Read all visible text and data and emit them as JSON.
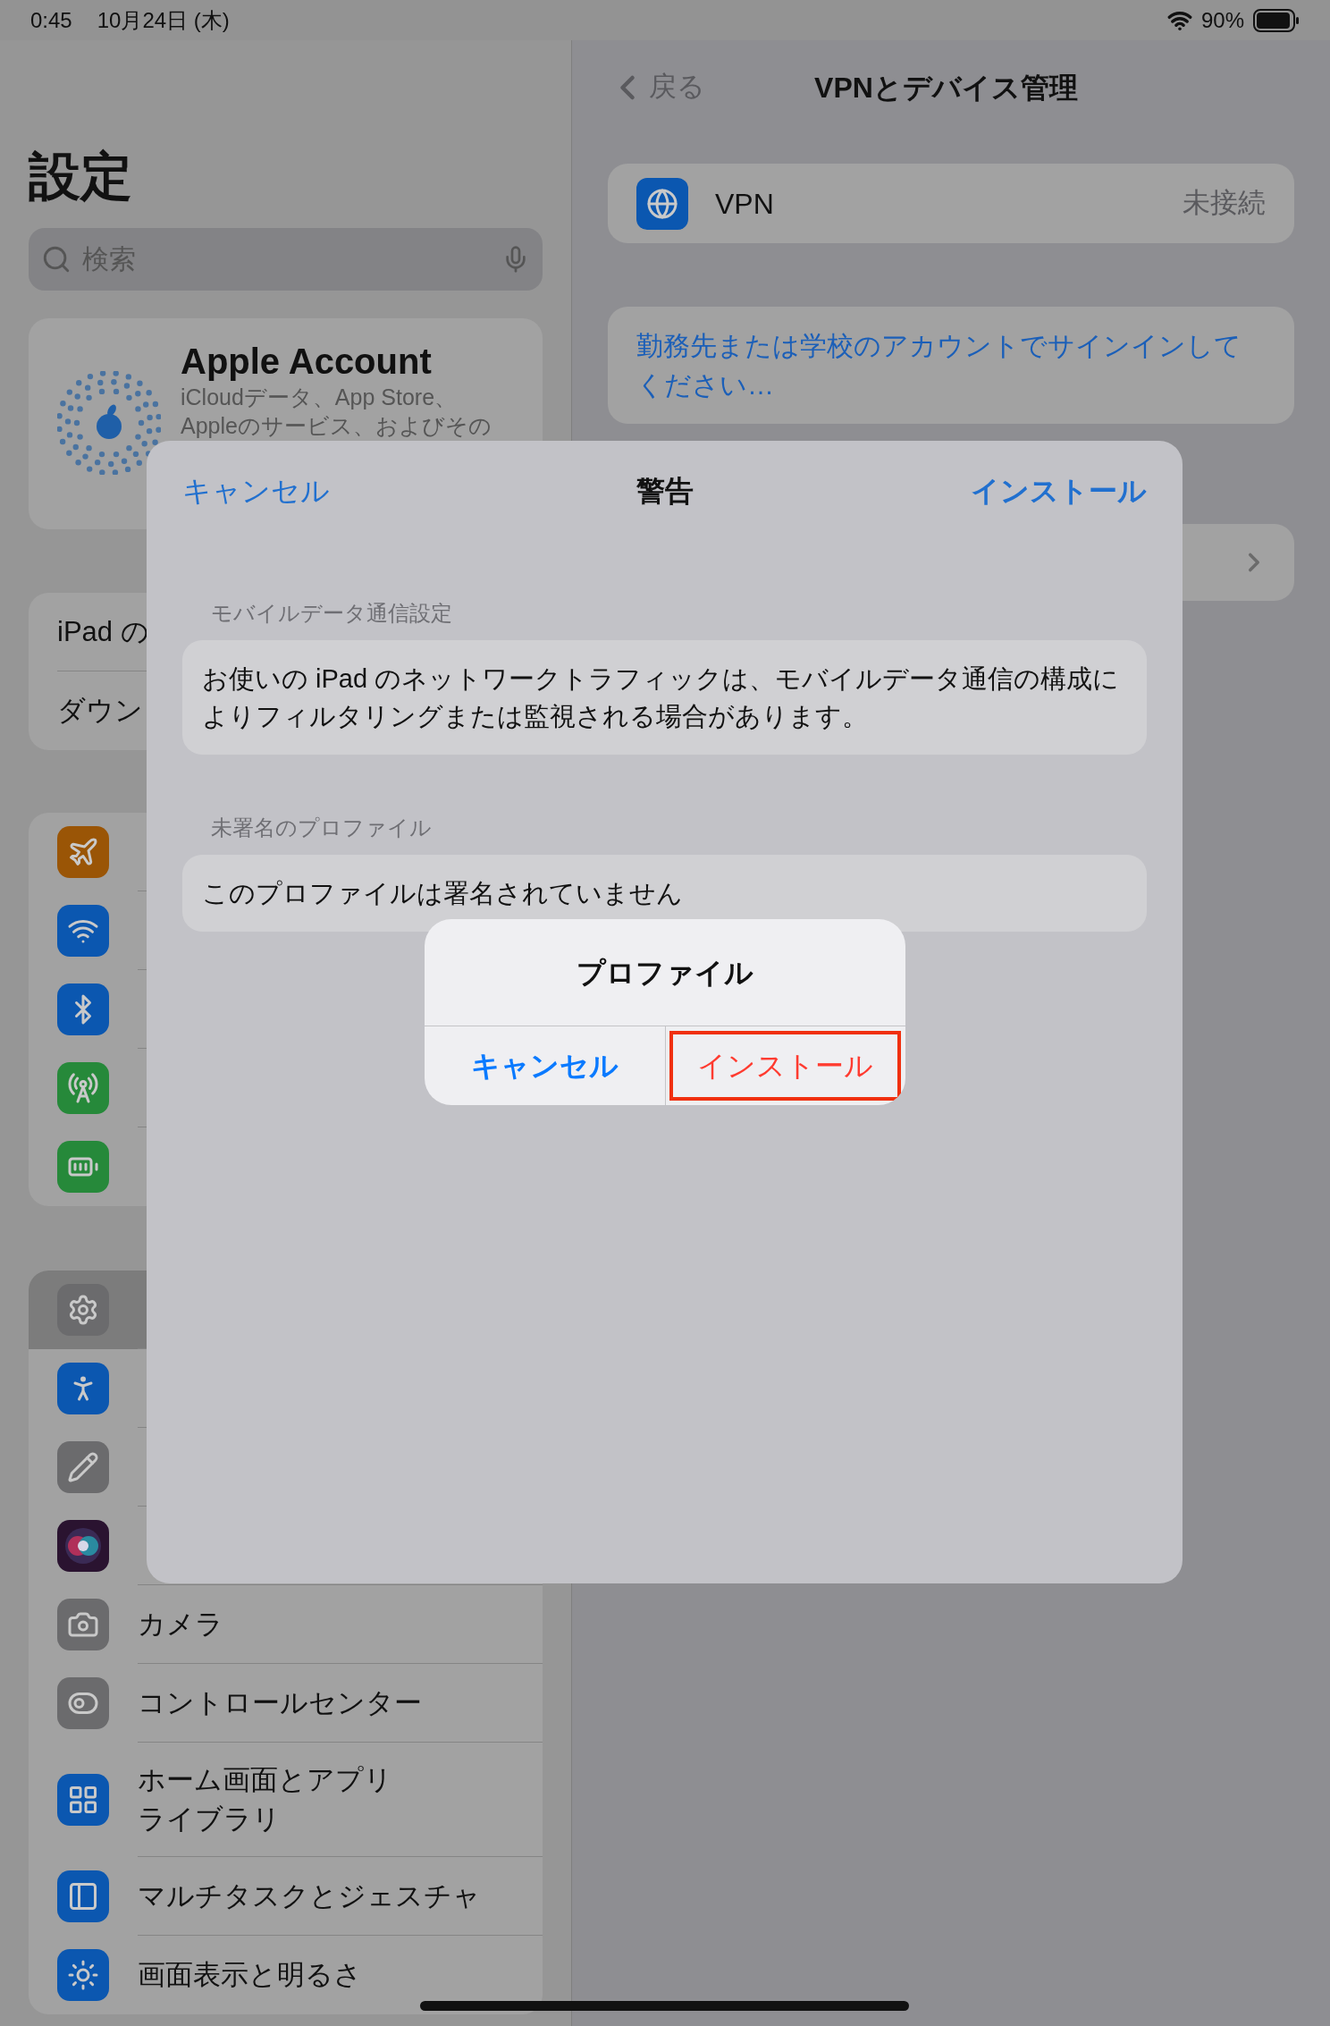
{
  "status_bar": {
    "time": "0:45",
    "date": "10月24日 (木)",
    "battery": "90%"
  },
  "sidebar": {
    "title": "設定",
    "search": {
      "placeholder": "検索"
    },
    "account": {
      "name": "Apple Account",
      "subtitle_lines": [
        "iCloudデータ、App Store、",
        "Appleのサービス、およびその"
      ]
    },
    "groups": [
      {
        "items": [
          {
            "label": "iPad の",
            "selected": false
          },
          {
            "label": "ダウン",
            "selected": false
          }
        ]
      },
      {
        "items": [
          {
            "color": "#9a5506",
            "selected": false
          },
          {
            "color": "#0b57b0",
            "selected": false
          },
          {
            "color": "#0b57b0",
            "selected": false
          },
          {
            "color": "#26893a",
            "selected": false
          },
          {
            "color": "#26893a",
            "selected": false
          }
        ]
      },
      {
        "items": [
          {
            "color": "#6b6b6d",
            "selected": true
          },
          {
            "color": "#0b57b0",
            "selected": false
          },
          {
            "color": "#6b6b6d",
            "selected": false
          },
          {
            "color": "#2a1330",
            "selected": false
          },
          {
            "color": "#6b6b6d",
            "label": "カメラ",
            "selected": false
          },
          {
            "color": "#6b6b6d",
            "label": "コントロールセンター",
            "selected": false
          },
          {
            "color": "#0b57b0",
            "label_lines": [
              "ホーム画面とアプリ",
              "ライブラリ"
            ],
            "selected": false
          },
          {
            "color": "#0b57b0",
            "label": "マルチタスクとジェスチャ",
            "selected": false
          },
          {
            "color": "#0b57b0",
            "label": "画面表示と明るさ",
            "selected": false
          }
        ]
      }
    ]
  },
  "detail": {
    "back": "戻る",
    "title": "VPNとデバイス管理",
    "vpn": {
      "label": "VPN",
      "status": "未接続"
    },
    "signin_link": "勤務先または学校のアカウントでサインインしてください…"
  },
  "sheet": {
    "cancel": "キャンセル",
    "title": "警告",
    "install": "インストール",
    "sections": [
      {
        "header": "モバイルデータ通信設定",
        "text": "お使いの iPad のネットワークトラフィックは、モバイルデータ通信の構成によりフィルタリングまたは監視される場合があります。"
      },
      {
        "header": "未署名のプロファイル",
        "text": "このプロファイルは署名されていません"
      }
    ]
  },
  "alert": {
    "title": "プロファイル",
    "buttons": [
      {
        "label": "キャンセル",
        "kind": "cancel",
        "highlighted": false
      },
      {
        "label": "インストール",
        "kind": "destructive",
        "highlighted": true
      }
    ]
  }
}
